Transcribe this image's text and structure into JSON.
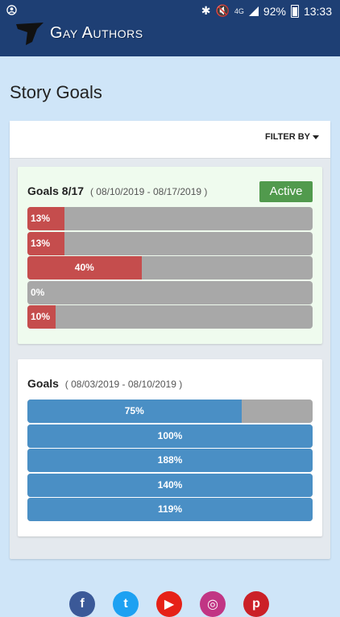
{
  "status_bar": {
    "battery": "92%",
    "time": "13:33",
    "network": "4G"
  },
  "header": {
    "brand": "Gay Authors"
  },
  "page": {
    "title": "Story Goals",
    "filter_label": "FILTER BY"
  },
  "goals": [
    {
      "name": "Goals 8/17",
      "dates": "( 08/10/2019 - 08/17/2019 )",
      "badge": "Active",
      "color": "#c54d4d",
      "bars": [
        {
          "label": "13%",
          "value": 13
        },
        {
          "label": "13%",
          "value": 13
        },
        {
          "label": "40%",
          "value": 40
        },
        {
          "label": "0%",
          "value": 0
        },
        {
          "label": "10%",
          "value": 10
        }
      ]
    },
    {
      "name": "Goals",
      "dates": "( 08/03/2019 - 08/10/2019 )",
      "badge": "",
      "color": "#4a8fc5",
      "bars": [
        {
          "label": "75%",
          "value": 75
        },
        {
          "label": "100%",
          "value": 100
        },
        {
          "label": "188%",
          "value": 188
        },
        {
          "label": "140%",
          "value": 140
        },
        {
          "label": "119%",
          "value": 119
        }
      ]
    }
  ],
  "social": [
    {
      "name": "facebook-icon",
      "glyph": "f",
      "color": "#3b5998"
    },
    {
      "name": "twitter-icon",
      "glyph": "t",
      "color": "#1da1f2"
    },
    {
      "name": "youtube-icon",
      "glyph": "▶",
      "color": "#e62117"
    },
    {
      "name": "instagram-icon",
      "glyph": "◎",
      "color": "#c13584"
    },
    {
      "name": "pinterest-icon",
      "glyph": "p",
      "color": "#cb2027"
    }
  ]
}
